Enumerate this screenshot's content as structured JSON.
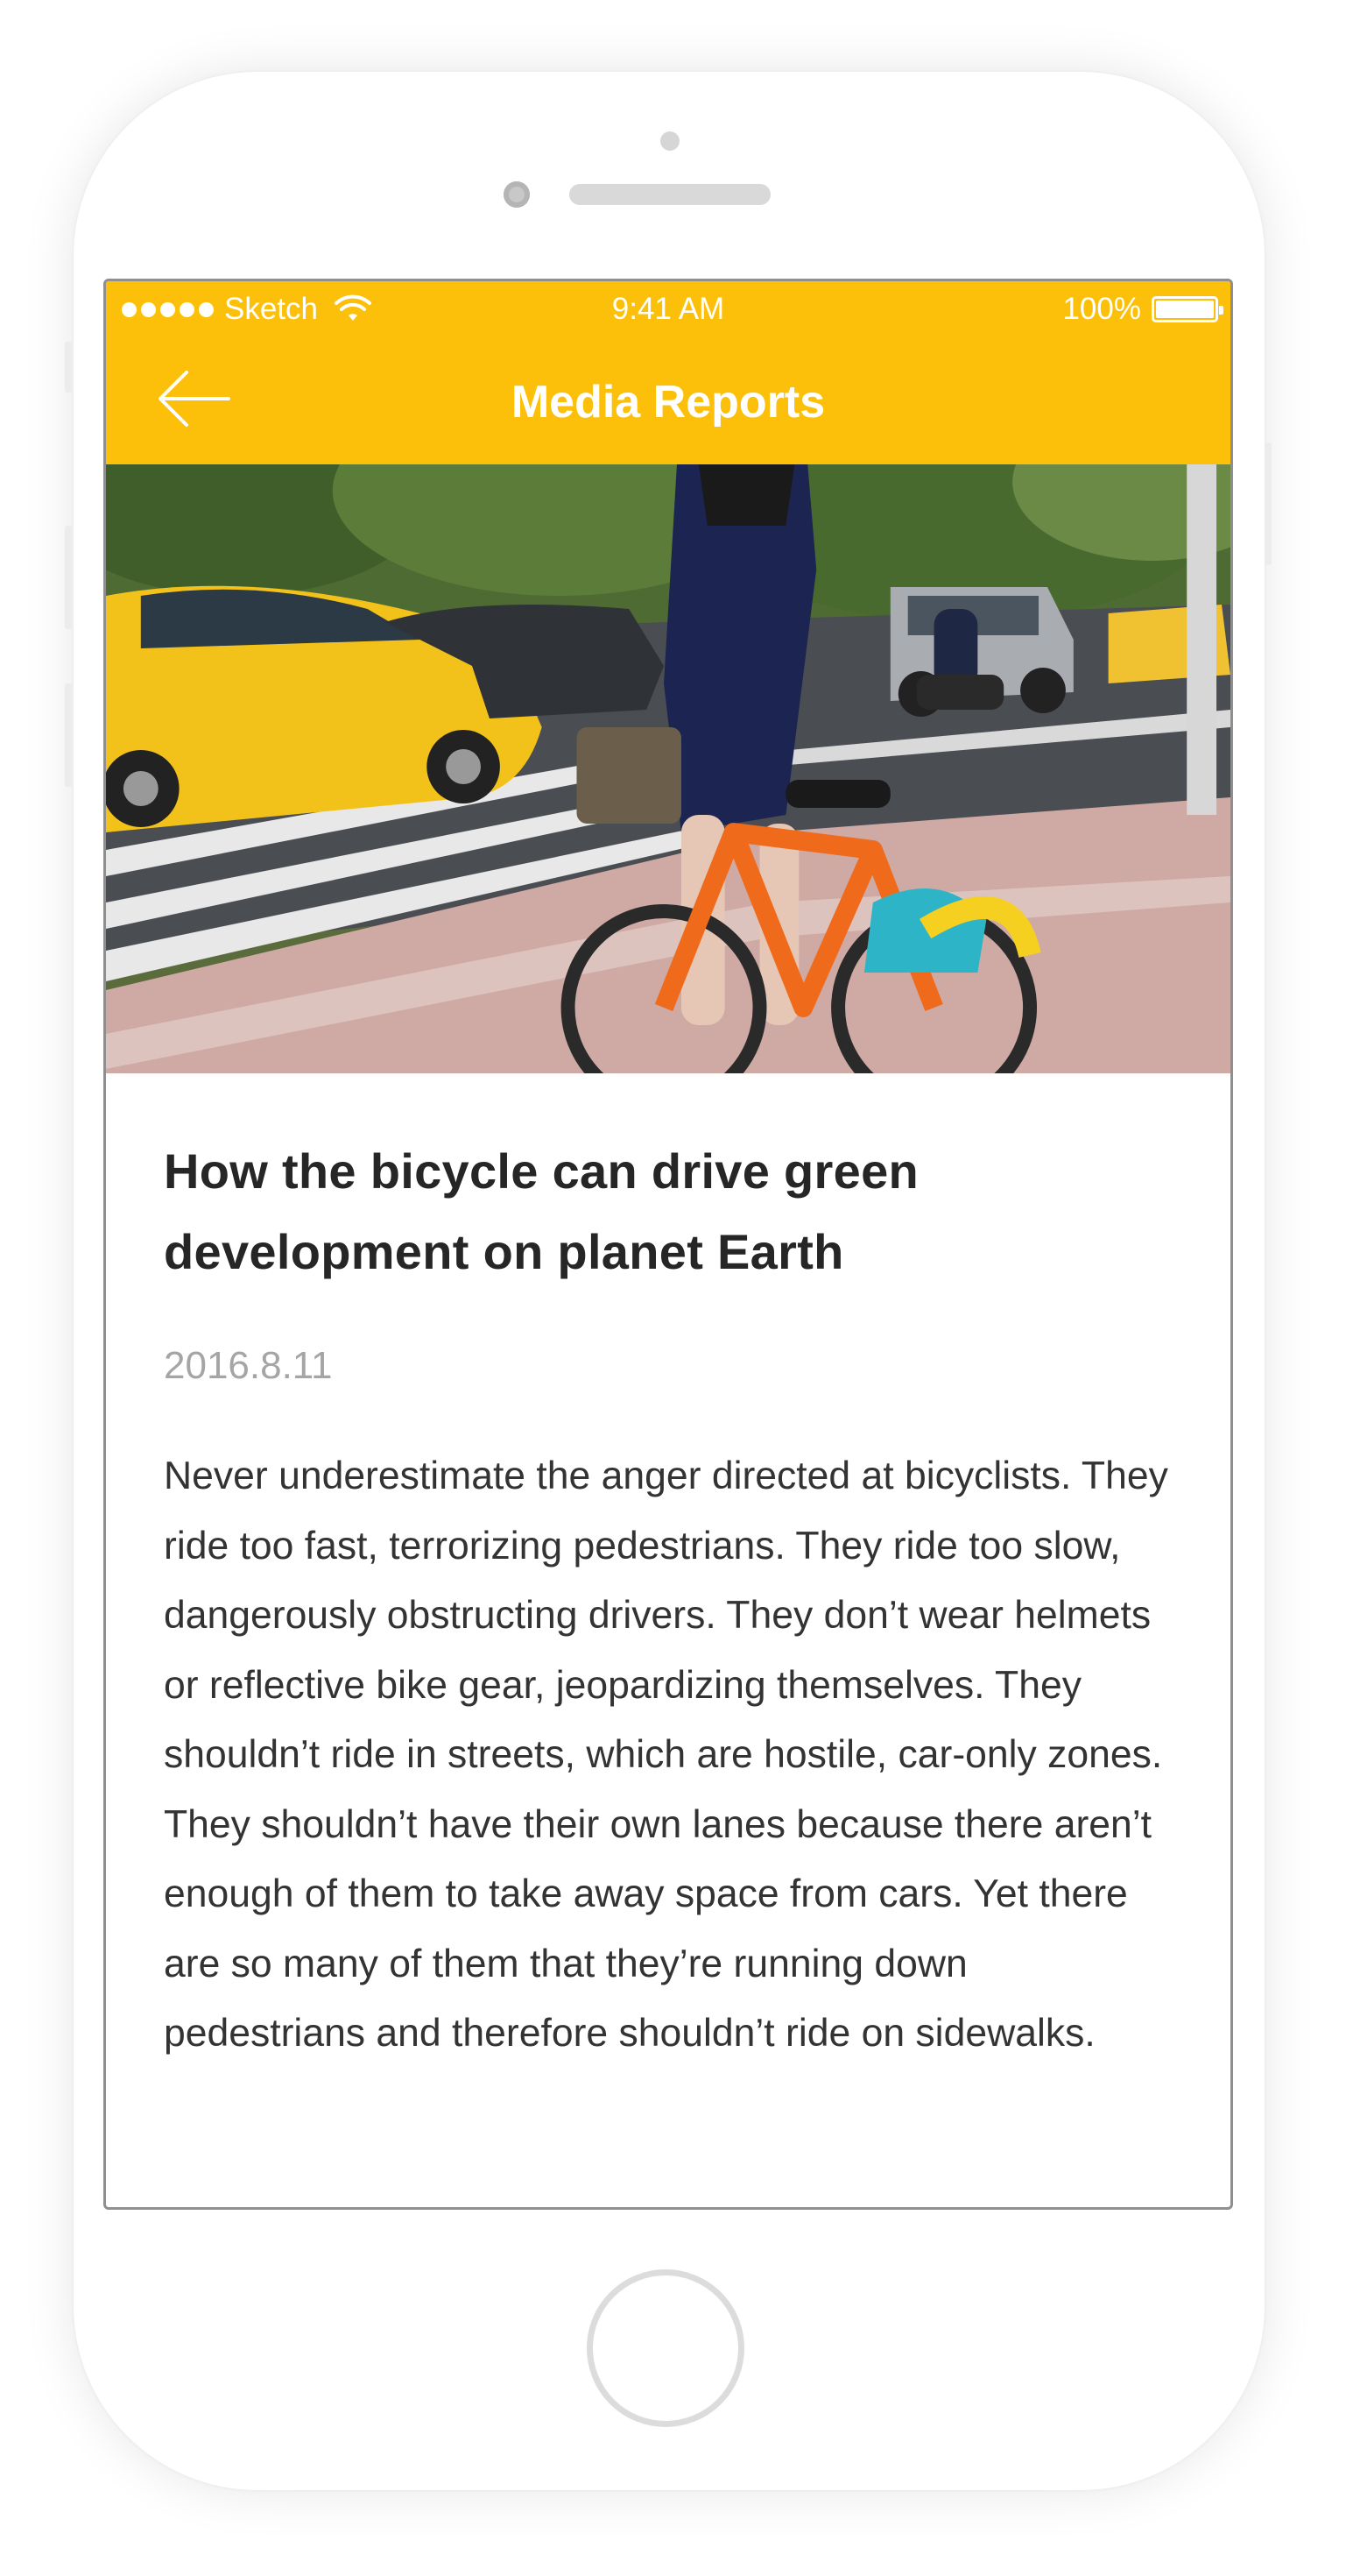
{
  "status_bar": {
    "carrier": "Sketch",
    "time": "9:41 AM",
    "battery": "100%",
    "battery_level": 1.0,
    "signal_icon": "signal-dots-icon",
    "wifi_icon": "wifi-icon",
    "battery_icon": "battery-icon"
  },
  "nav": {
    "title": "Media Reports",
    "back_icon": "arrow-left-icon"
  },
  "hero_image": {
    "subject": "photo-woman-with-orange-bicycle-at-crosswalk"
  },
  "article": {
    "title": "How the bicycle can drive green development on planet Earth",
    "date": "2016.8.11",
    "body": "Never underestimate the anger directed at bicyclists. They ride too fast, terrorizing pedestrians. They ride too slow, dangerously obstructing drivers. They don’t wear helmets or reflective bike gear, jeopardizing themselves. They shouldn’t ride in streets, which are hostile, car-only zones. They shouldn’t have their own lanes because there aren’t enough of them to take away space from cars. Yet there are so many of them that they’re running down pedestrians and therefore shouldn’t ride on sidewalks."
  },
  "colors": {
    "accent": "#fcbf0a",
    "title_text": "#262626",
    "date_text": "#a5a5a5",
    "body_text": "#333333"
  }
}
